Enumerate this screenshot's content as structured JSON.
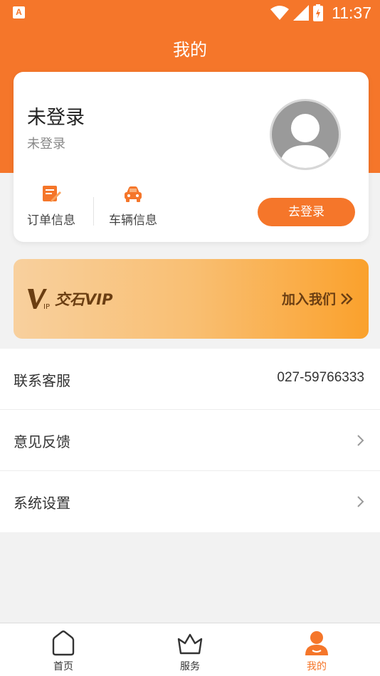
{
  "status_bar": {
    "time": "11:37"
  },
  "header": {
    "title": "我的"
  },
  "user_card": {
    "name": "未登录",
    "subtitle": "未登录",
    "quick_links": [
      {
        "label": "订单信息",
        "icon": "order-icon"
      },
      {
        "label": "车辆信息",
        "icon": "car-icon"
      }
    ],
    "login_button": "去登录"
  },
  "vip_banner": {
    "brand": "交石VIP",
    "join_label": "加入我们"
  },
  "menu": [
    {
      "label": "联系客服",
      "value": "027-59766333"
    },
    {
      "label": "意见反馈"
    },
    {
      "label": "系统设置"
    }
  ],
  "tabbar": [
    {
      "label": "首页",
      "icon": "home-icon"
    },
    {
      "label": "服务",
      "icon": "crown-icon"
    },
    {
      "label": "我的",
      "icon": "user-icon",
      "active": true
    }
  ],
  "colors": {
    "accent": "#f5762a",
    "vip_text": "#6b3e12"
  }
}
